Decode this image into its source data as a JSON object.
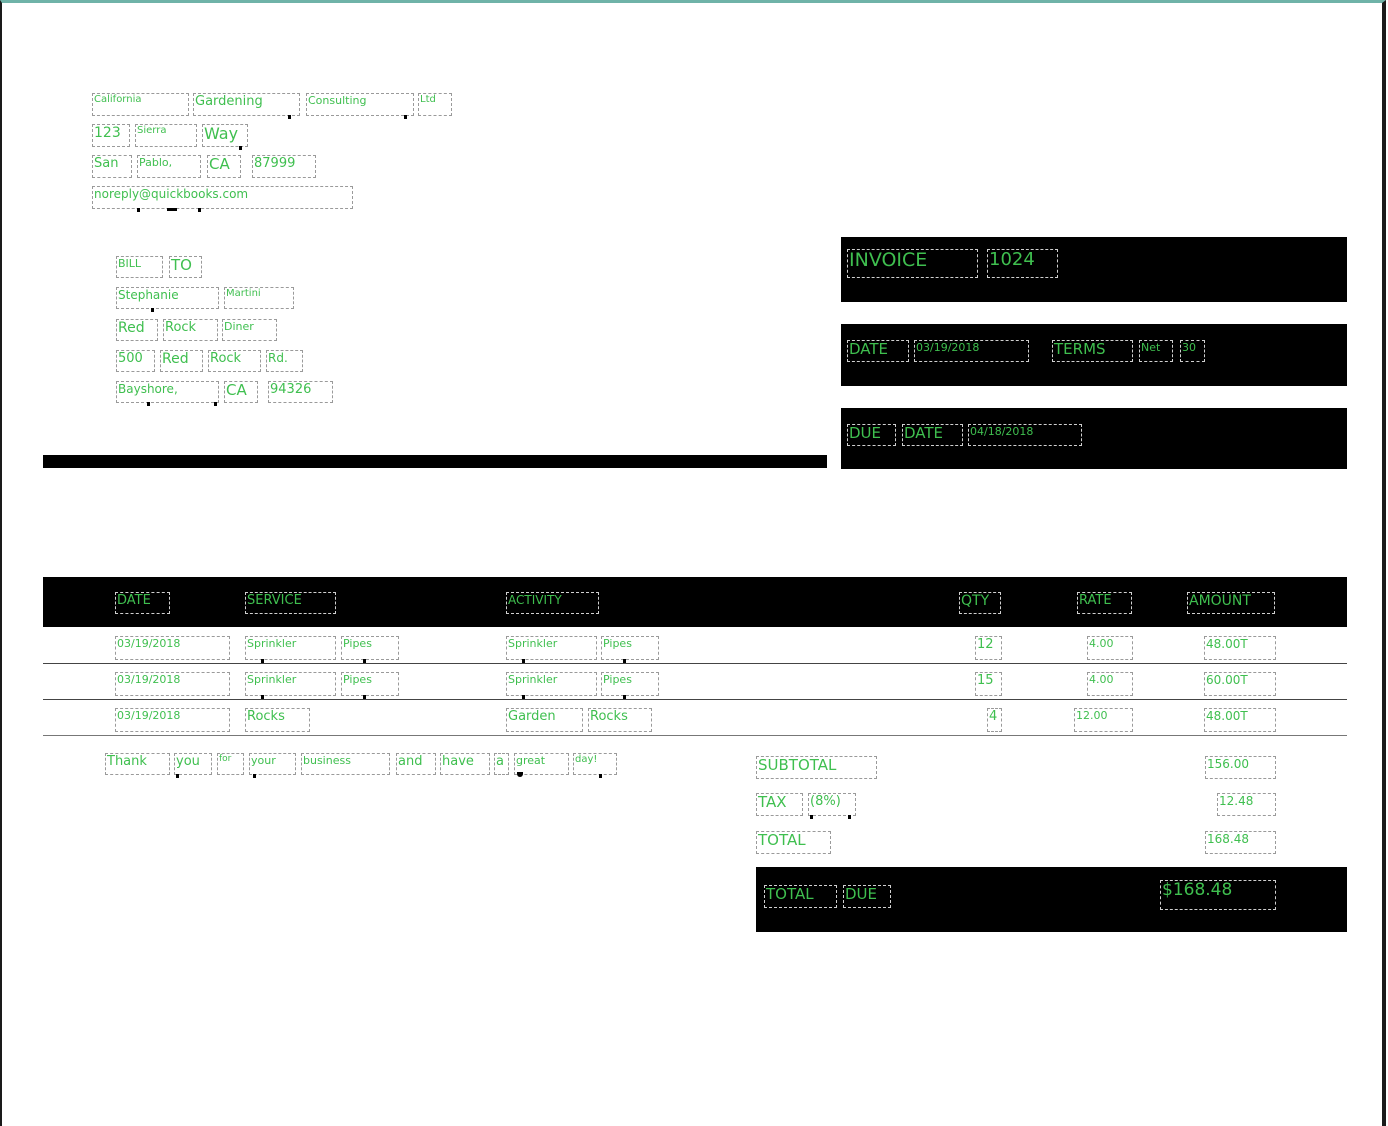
{
  "company": {
    "name": [
      "California",
      "Gardening",
      "Consulting",
      "Ltd"
    ],
    "street": [
      "123",
      "Sierra",
      "Way"
    ],
    "city_line": [
      "San",
      "Pablo,",
      "CA",
      "87999"
    ],
    "email": "noreply@quickbooks.com"
  },
  "bill_to": {
    "heading": [
      "BILL",
      "TO"
    ],
    "name": [
      "Stephanie",
      "Martini"
    ],
    "business": [
      "Red",
      "Rock",
      "Diner"
    ],
    "street": [
      "500",
      "Red",
      "Rock",
      "Rd."
    ],
    "city_line": [
      "Bayshore,",
      "CA",
      "94326"
    ]
  },
  "invoice": {
    "label": "INVOICE",
    "number": "1024",
    "date_label": "DATE",
    "date": "03/19/2018",
    "terms_label": "TERMS",
    "terms": [
      "Net",
      "30"
    ],
    "due_date_label": [
      "DUE",
      "DATE"
    ],
    "due_date": "04/18/2018"
  },
  "table": {
    "headers": [
      "DATE",
      "SERVICE",
      "ACTIVITY",
      "QTY",
      "RATE",
      "AMOUNT"
    ],
    "rows": [
      {
        "date": "03/19/2018",
        "service": [
          "Sprinkler",
          "Pipes"
        ],
        "activity": [
          "Sprinkler",
          "Pipes"
        ],
        "qty": "12",
        "rate": "4.00",
        "amount": "48.00T"
      },
      {
        "date": "03/19/2018",
        "service": [
          "Sprinkler",
          "Pipes"
        ],
        "activity": [
          "Sprinkler",
          "Pipes"
        ],
        "qty": "15",
        "rate": "4.00",
        "amount": "60.00T"
      },
      {
        "date": "03/19/2018",
        "service": [
          "Rocks"
        ],
        "activity": [
          "Garden",
          "Rocks"
        ],
        "qty": "4",
        "rate": "12.00",
        "amount": "48.00T"
      }
    ]
  },
  "footer_note": [
    "Thank",
    "you",
    "for",
    "your",
    "business",
    "and",
    "have",
    "a",
    "great",
    "day!"
  ],
  "totals": {
    "subtotal_label": "SUBTOTAL",
    "subtotal": "156.00",
    "tax_label": [
      "TAX",
      "(8%)"
    ],
    "tax": "12.48",
    "total_label": "TOTAL",
    "total": "168.48",
    "total_due_label": [
      "TOTAL",
      "DUE"
    ],
    "total_due": "$168.48"
  }
}
